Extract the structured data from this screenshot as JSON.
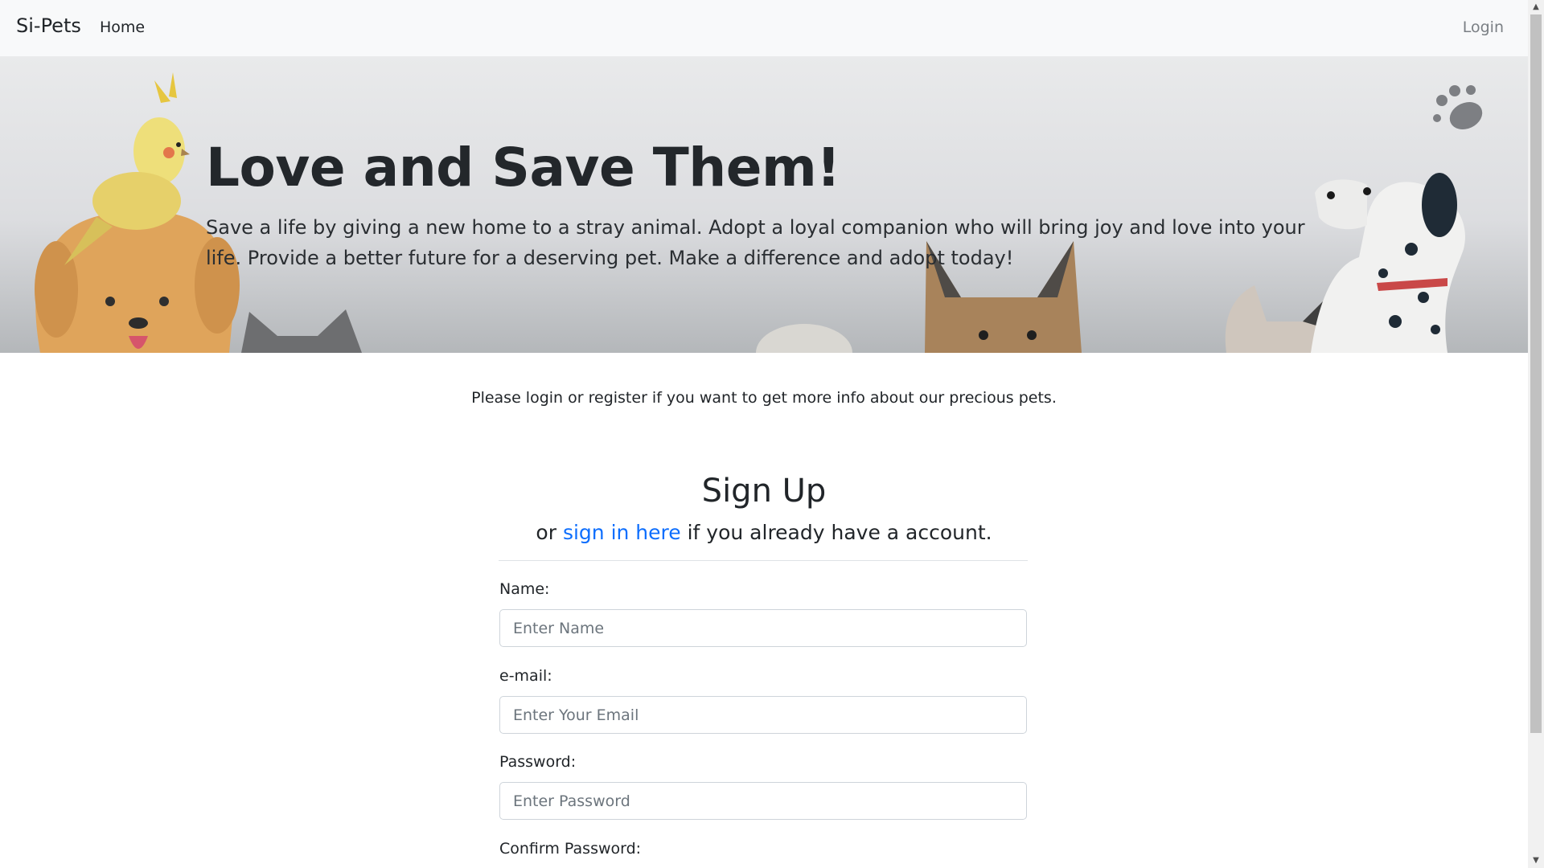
{
  "navbar": {
    "brand": "Si-Pets",
    "home": "Home",
    "login": "Login"
  },
  "hero": {
    "title": "Love and Save Them!",
    "text": "Save a life by giving a new home to a stray animal. Adopt a loyal companion who will bring joy and love into your life. Provide a better future for a deserving pet. Make a difference and adopt today!"
  },
  "notice": "Please login or register if you want to get more info about our precious pets.",
  "signup": {
    "title": "Sign Up",
    "sub_prefix": "or ",
    "sub_link": "sign in here",
    "sub_suffix": " if you already have a account.",
    "name_label": "Name:",
    "name_placeholder": "Enter Name",
    "email_label": "e-mail:",
    "email_placeholder": "Enter Your Email",
    "password_label": "Password:",
    "password_placeholder": "Enter Password",
    "confirm_label": "Confirm Password:"
  },
  "colors": {
    "link": "#0d6efd",
    "navbar_bg": "#f8f9fa"
  },
  "icons": [
    "paw-icon",
    "heart-icon",
    "scroll-up-arrow-icon",
    "scroll-down-arrow-icon"
  ]
}
